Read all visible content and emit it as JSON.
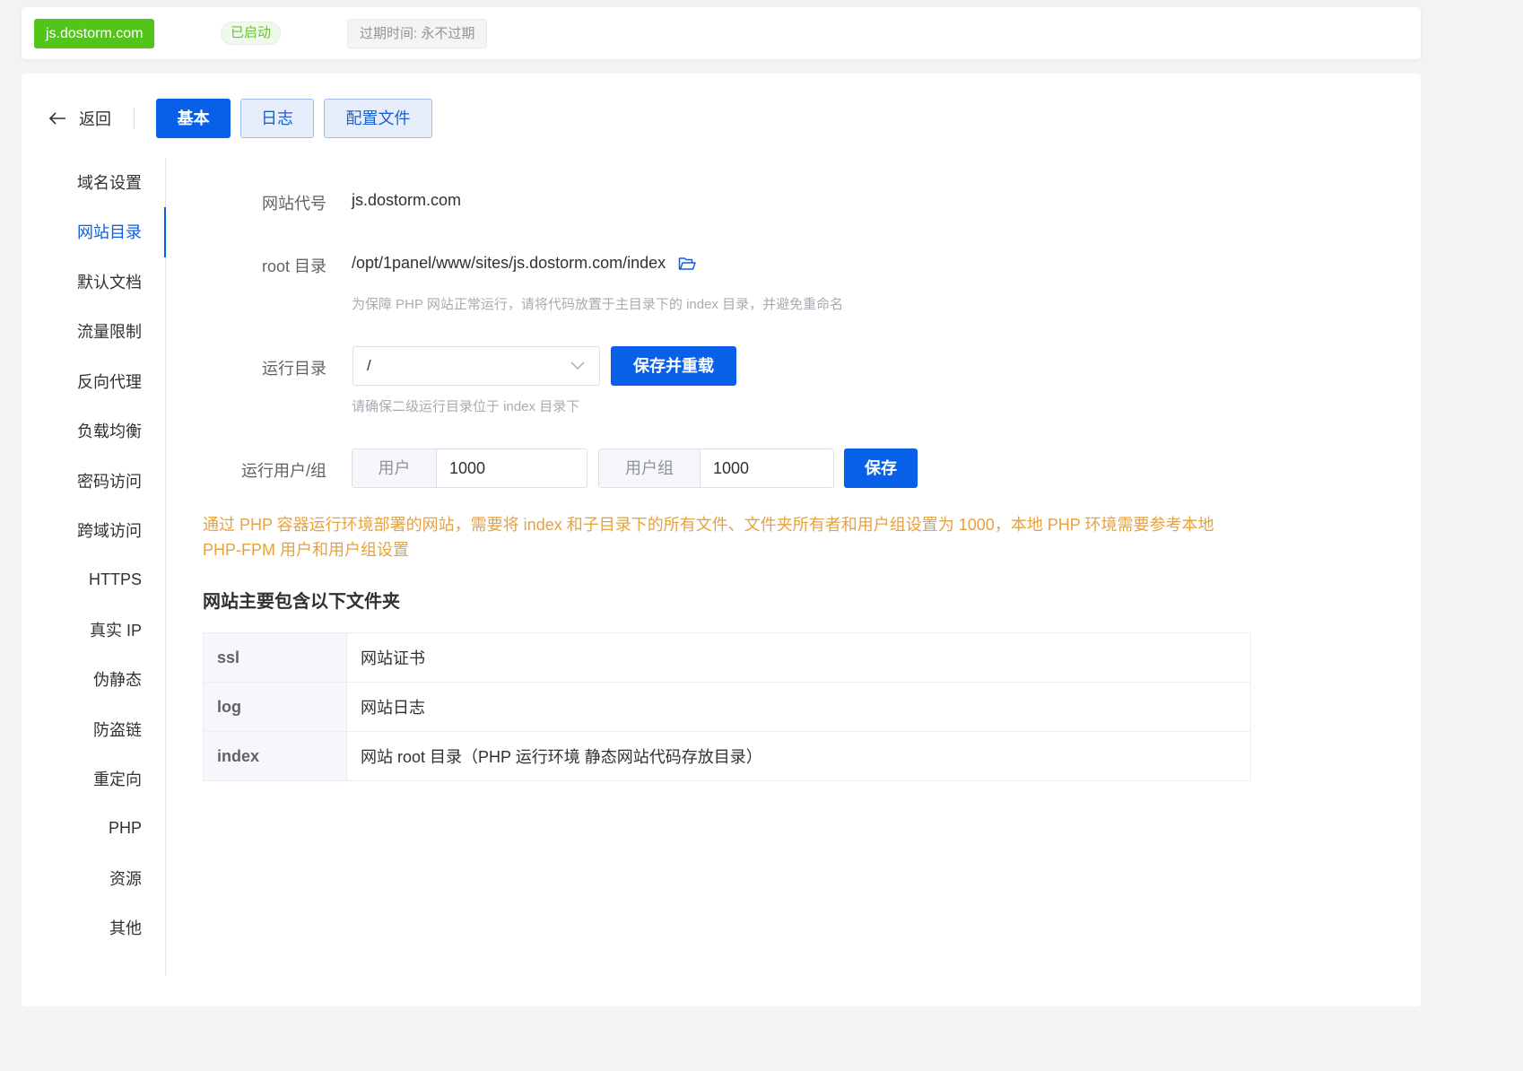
{
  "header": {
    "site_name": "js.dostorm.com",
    "status": "已启动",
    "expire": "过期时间: 永不过期"
  },
  "nav": {
    "back_label": "返回",
    "tabs": [
      {
        "label": "基本",
        "active": true
      },
      {
        "label": "日志",
        "active": false
      },
      {
        "label": "配置文件",
        "active": false
      }
    ]
  },
  "menu": {
    "active": "网站目录",
    "items": [
      "域名设置",
      "网站目录",
      "默认文档",
      "流量限制",
      "反向代理",
      "负载均衡",
      "密码访问",
      "跨域访问",
      "HTTPS",
      "真实 IP",
      "伪静态",
      "防盗链",
      "重定向",
      "PHP",
      "资源",
      "其他"
    ]
  },
  "form": {
    "site_code_label": "网站代号",
    "site_code_value": "js.dostorm.com",
    "root_label": "root 目录",
    "root_value": "/opt/1panel/www/sites/js.dostorm.com/index",
    "root_hint": "为保障 PHP 网站正常运行，请将代码放置于主目录下的 index 目录，并避免重命名",
    "run_dir_label": "运行目录",
    "run_dir_value": "/",
    "save_reload_label": "保存并重载",
    "run_dir_hint": "请确保二级运行目录位于 index 目录下",
    "run_user_label": "运行用户/组",
    "user_prepend": "用户",
    "user_value": "1000",
    "group_prepend": "用户组",
    "group_value": "1000",
    "save_label": "保存"
  },
  "warning_text": "通过 PHP 容器运行环境部署的网站，需要将 index 和子目录下的所有文件、文件夹所有者和用户组设置为 1000，本地 PHP 环境需要参考本地 PHP-FPM 用户和用户组设置",
  "folders": {
    "title": "网站主要包含以下文件夹",
    "rows": [
      {
        "name": "ssl",
        "desc": "网站证书"
      },
      {
        "name": "log",
        "desc": "网站日志"
      },
      {
        "name": "index",
        "desc": "网站 root 目录（PHP 运行环境 静态网站代码存放目录）"
      }
    ]
  },
  "colors": {
    "primary": "#0960e8",
    "success": "#52c41a",
    "warning": "#e6a23c"
  },
  "icons": {
    "back": "arrow-left-icon",
    "folder": "folder-open-icon",
    "dropdown": "chevron-down-icon"
  }
}
